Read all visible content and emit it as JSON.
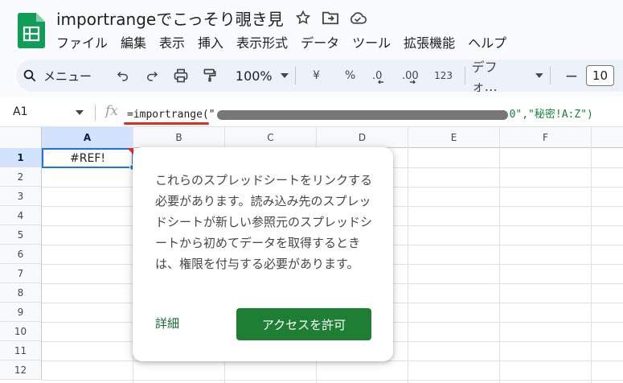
{
  "document": {
    "title": "importrangeでこっそり覗き見"
  },
  "menubar": {
    "items": [
      "ファイル",
      "編集",
      "表示",
      "挿入",
      "表示形式",
      "データ",
      "ツール",
      "拡張機能",
      "ヘルプ"
    ]
  },
  "toolbar": {
    "menu_search": "メニュー",
    "zoom": "100%",
    "currency": "¥",
    "percent": "%",
    "decrease_decimal": ".0",
    "increase_decimal": ".00",
    "number_format": "123",
    "font": "デフォ…",
    "font_size": "10",
    "minus": "−",
    "plus": "+"
  },
  "formula_bar": {
    "cell_ref": "A1",
    "fx": "fx",
    "formula_prefix": "=importrange(\"",
    "formula_tail": "0\",\"秘密!A:Z\")"
  },
  "sheet": {
    "columns": [
      "A",
      "B",
      "C",
      "D",
      "E",
      "F"
    ],
    "rows": [
      "1",
      "2",
      "3",
      "4",
      "5",
      "6",
      "7",
      "8",
      "9",
      "10",
      "11",
      "12"
    ],
    "a1_value": "#REF!"
  },
  "popup": {
    "message": "これらのスプレッドシートをリンクする必要があります。読み込み先のスプレッドシートが新しい参照元のスプレッドシートから初めてデータを取得するときは、権限を付与する必要があります。",
    "details_link": "詳細",
    "allow_button": "アクセスを許可"
  },
  "colors": {
    "accent": "#1a73e8",
    "error": "#d93025",
    "allow_button": "#1e7e34",
    "sheets_logo": "#0f9d58"
  }
}
